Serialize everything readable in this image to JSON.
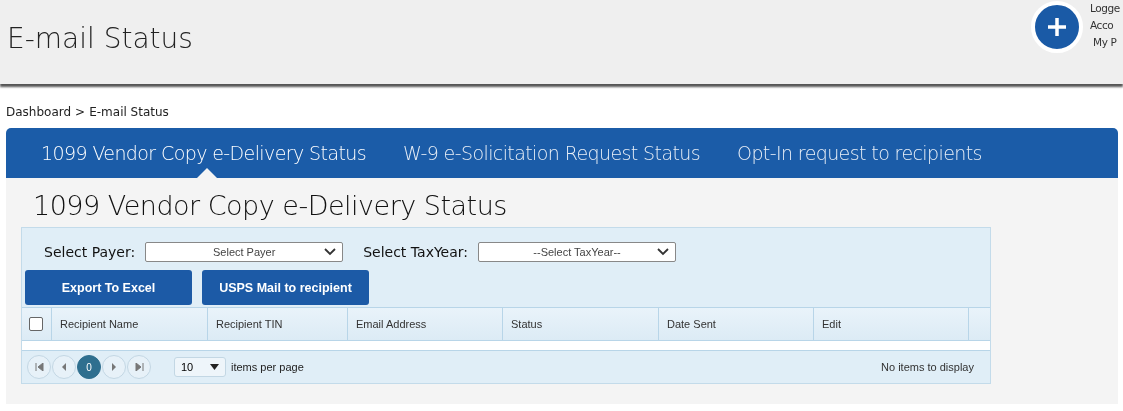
{
  "header": {
    "title": "E-mail Status",
    "user_lines": [
      "Logge",
      "Acco",
      "My P"
    ]
  },
  "breadcrumb": [
    "Dashboard",
    ">",
    "E-mail Status"
  ],
  "tabs": [
    {
      "label": "1099 Vendor Copy e-Delivery Status",
      "selected": true
    },
    {
      "label": "W-9 e-Solicitation Request Status",
      "selected": false
    },
    {
      "label": "Opt-In request to recipients",
      "selected": false
    }
  ],
  "heading": "1099 Vendor Copy e-Delivery Status",
  "filters": [
    {
      "label": "Select Payer:",
      "value": "Select Payer"
    },
    {
      "label": "Select TaxYear:",
      "value": "--Select TaxYear--"
    }
  ],
  "buttons": [
    "Export To Excel",
    "USPS Mail to recipient"
  ],
  "table": {
    "select_all_checked": false,
    "columns": [
      "Recipient Name",
      "Recipient TIN",
      "Email Address",
      "Status",
      "Date Sent",
      "Edit"
    ]
  },
  "pager": {
    "pages": [
      {
        "label": "0",
        "selected": true
      }
    ],
    "page_size": "10",
    "page_size_label": "items per page",
    "status": "No items to display"
  }
}
